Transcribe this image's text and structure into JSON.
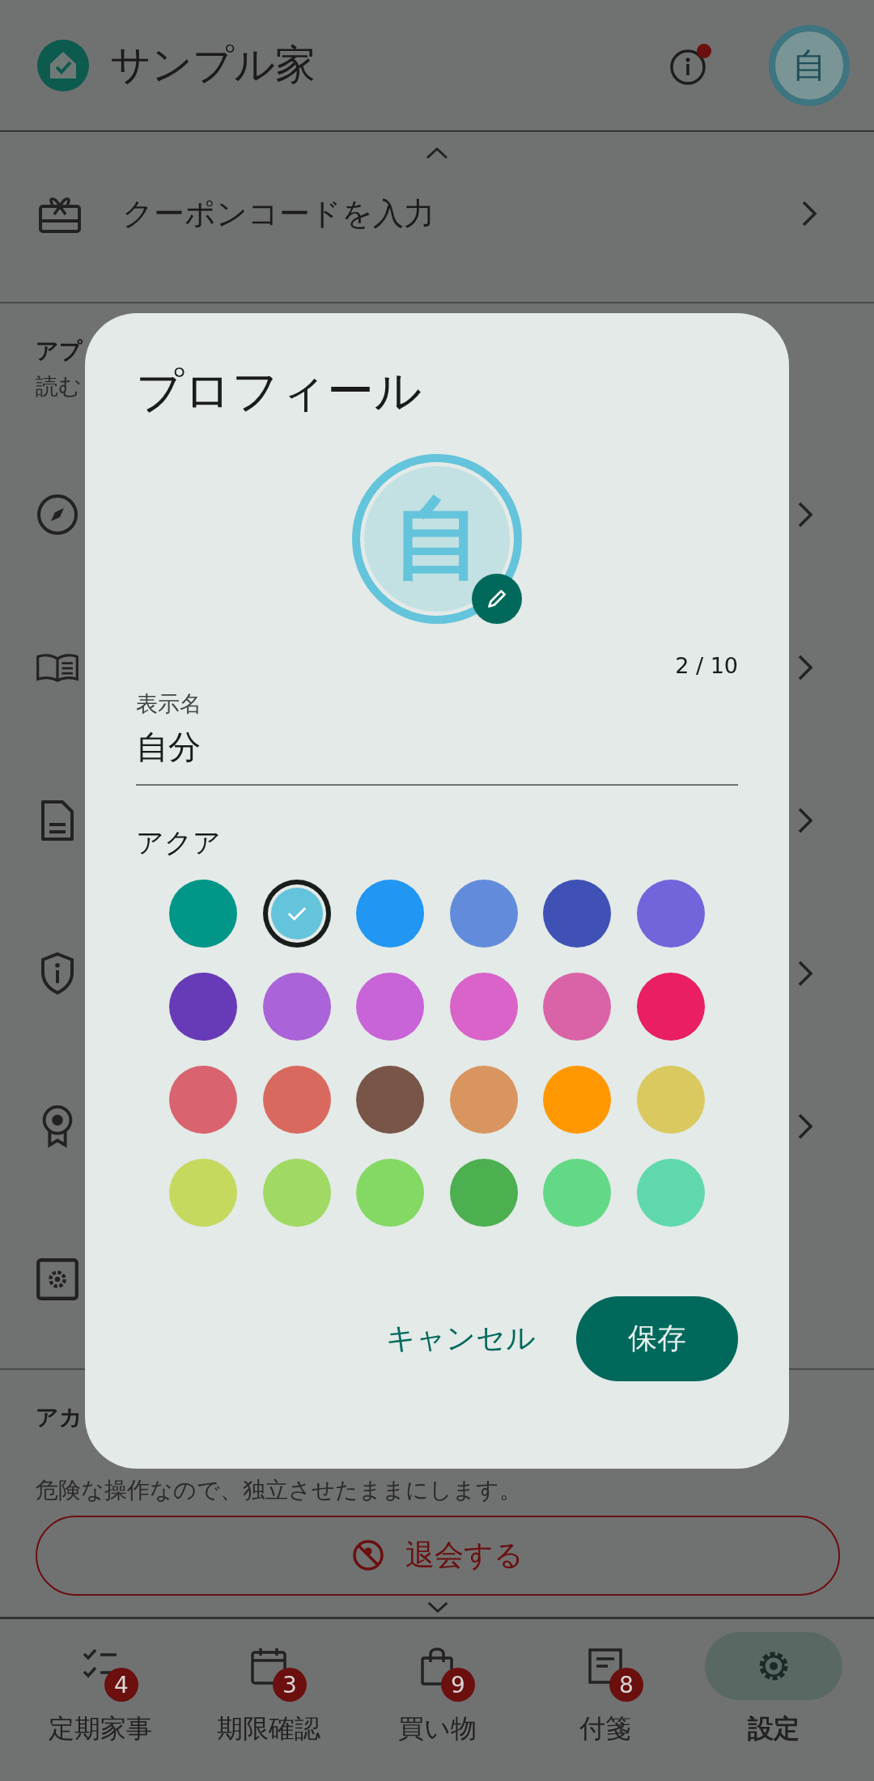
{
  "app_bar": {
    "title": "サンプル家",
    "notification": true,
    "avatar": "自"
  },
  "coupon": {
    "label": "クーポンコードを入力"
  },
  "app_section": {
    "title": "アプ",
    "subtitle": "読む"
  },
  "rows": [
    {
      "chevron": true
    },
    {
      "chevron": true
    },
    {
      "chevron": true
    },
    {
      "chevron": true
    },
    {
      "chevron": true
    },
    {
      "chevron": false
    }
  ],
  "account_section": {
    "title": "アカ",
    "subtitle": "危険な操作なので、独立させたままにします。",
    "button": "退会する"
  },
  "nav": [
    {
      "label": "定期家事",
      "badge": "4",
      "selected": false
    },
    {
      "label": "期限確認",
      "badge": "3",
      "selected": false
    },
    {
      "label": "買い物",
      "badge": "9",
      "selected": false
    },
    {
      "label": "付箋",
      "badge": "8",
      "selected": false
    },
    {
      "label": "設定",
      "selected": true
    }
  ],
  "dialog": {
    "title": "プロフィール",
    "avatar": "自",
    "counter": "2 / 10",
    "field_label": "表示名",
    "field_value": "自分",
    "color_name": "アクア",
    "colors": [
      {
        "color": "#009688",
        "selected": false
      },
      {
        "color": "#64c4dc",
        "selected": true
      },
      {
        "color": "#2196f3",
        "selected": false
      },
      {
        "color": "#628cdb",
        "selected": false
      },
      {
        "color": "#3f51b5",
        "selected": false
      },
      {
        "color": "#7264da",
        "selected": false
      },
      {
        "color": "#673ab7",
        "selected": false
      },
      {
        "color": "#aa63d8",
        "selected": false
      },
      {
        "color": "#c963d8",
        "selected": false
      },
      {
        "color": "#d963c9",
        "selected": false
      },
      {
        "color": "#d963a6",
        "selected": false
      },
      {
        "color": "#e91e63",
        "selected": false
      },
      {
        "color": "#d9636e",
        "selected": false
      },
      {
        "color": "#d9695f",
        "selected": false
      },
      {
        "color": "#795548",
        "selected": false
      },
      {
        "color": "#d9955f",
        "selected": false
      },
      {
        "color": "#ff9800",
        "selected": false
      },
      {
        "color": "#d9c95f",
        "selected": false
      },
      {
        "color": "#c5d95f",
        "selected": false
      },
      {
        "color": "#a0d963",
        "selected": false
      },
      {
        "color": "#83d963",
        "selected": false
      },
      {
        "color": "#4caf50",
        "selected": false
      },
      {
        "color": "#63d987",
        "selected": false
      },
      {
        "color": "#5fd9ab",
        "selected": false
      }
    ],
    "cancel": "キャンセル",
    "save": "保存"
  }
}
